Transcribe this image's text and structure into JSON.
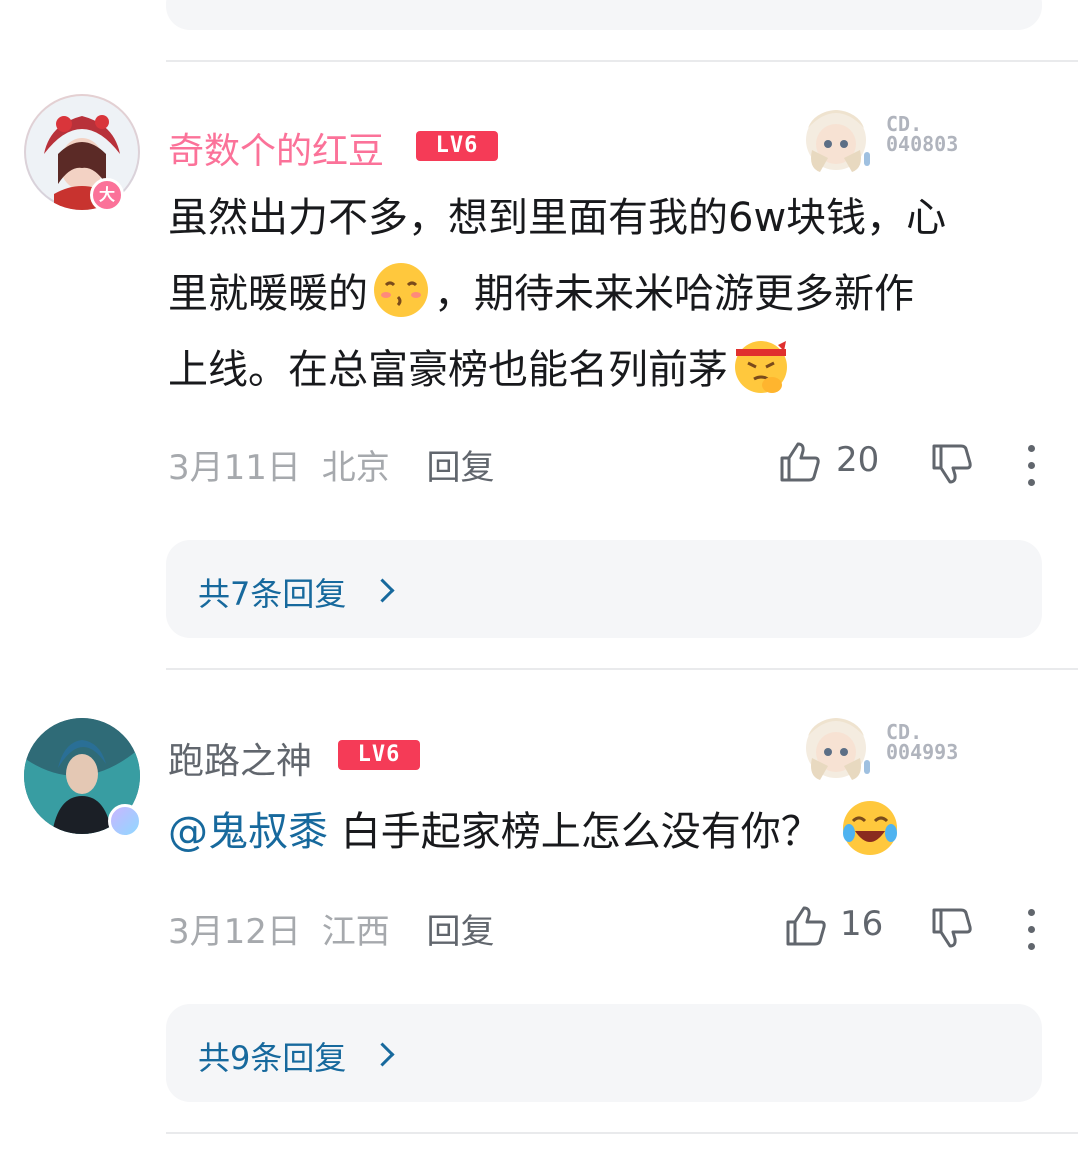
{
  "comments": [
    {
      "username": "奇数个的红豆",
      "level": "LV6",
      "fan_label": "CD.",
      "fan_number": "040803",
      "text_lines": [
        "虽然出力不多，想到里面有我的6w块钱，心",
        "里就暖暖的",
        "，期待未来米哈游更多新作",
        "上线。在总富豪榜也能名列前茅"
      ],
      "avatar_badge": "大",
      "date": "3月11日",
      "location": "北京",
      "reply_label": "回复",
      "likes": "20",
      "replies_summary": "共7条回复"
    },
    {
      "username": "跑路之神",
      "level": "LV6",
      "fan_label": "CD.",
      "fan_number": "004993",
      "mention": "@鬼叔黍",
      "text": " 白手起家榜上怎么没有你？",
      "date": "3月12日",
      "location": "江西",
      "reply_label": "回复",
      "likes": "16",
      "replies_summary": "共9条回复"
    }
  ],
  "colors": {
    "pink_name": "#fb7299",
    "link_blue": "#17699d",
    "level_red": "#f53b57",
    "muted": "#a6a9ad"
  },
  "icons": [
    "thumb-up-icon",
    "thumb-down-icon",
    "more-icon",
    "chevron-right-icon"
  ]
}
